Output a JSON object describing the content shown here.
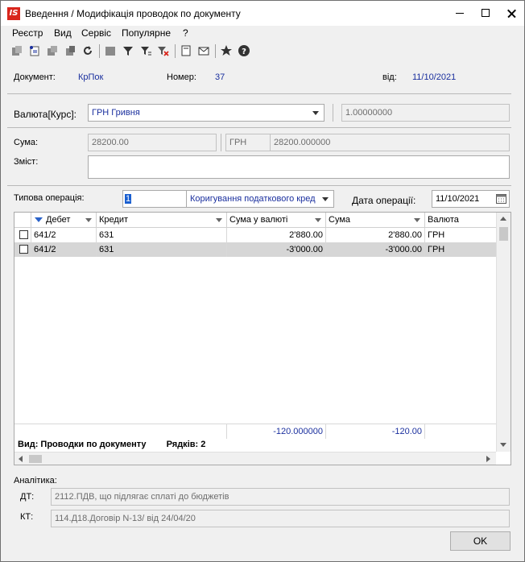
{
  "window": {
    "title": "Введення / Модифікація проводок по документу",
    "logo_text": "IS"
  },
  "menu": [
    "Реєстр",
    "Вид",
    "Сервіс",
    "Популярне",
    "?"
  ],
  "toolbar_icons": [
    "new-doc-icon",
    "open-doc-icon",
    "copy-doc-icon",
    "paste-doc-icon",
    "refresh-icon",
    "block-icon",
    "filter-icon",
    "filter-edit-icon",
    "clear-filter-icon",
    "page-icon",
    "mail-icon",
    "star-icon",
    "help-icon"
  ],
  "header": {
    "doc_label": "Документ:",
    "doc_value": "КрПок",
    "num_label": "Номер:",
    "num_value": "37",
    "date_label": "від:",
    "date_value": "11/10/2021"
  },
  "currency": {
    "label": "Валюта[Курс]:",
    "value": "ГРН Гривня",
    "rate": "1.00000000"
  },
  "amount": {
    "label": "Сума:",
    "value": "28200.00",
    "cur": "ГРН",
    "cur_value": "28200.000000"
  },
  "content": {
    "label": "Зміст:",
    "value": ""
  },
  "operation": {
    "label": "Типова операція:",
    "code": "1",
    "name": "Коригування податкового кред",
    "date_label": "Дата операції:",
    "date_value": "11/10/2021"
  },
  "grid": {
    "columns": [
      "Дебет",
      "Кредит",
      "Сума у валюті",
      "Сума",
      "Валюта"
    ],
    "rows": [
      {
        "debit": "641/2",
        "credit": "631",
        "sum_cur": "2'880.00",
        "sum": "2'880.00",
        "currency": "ГРН",
        "selected": false
      },
      {
        "debit": "641/2",
        "credit": "631",
        "sum_cur": "-3'000.00",
        "sum": "-3'000.00",
        "currency": "ГРН",
        "selected": true
      }
    ],
    "totals": {
      "sum_cur": "-120.000000",
      "sum": "-120.00"
    },
    "status_view": "Вид: Проводки по документу",
    "status_rows": "Рядків: 2"
  },
  "analytics": {
    "label": "Аналітика:",
    "dt_label": "ДТ:",
    "dt_value": "2112.ПДВ, що підлягає сплаті до бюджетів",
    "kt_label": "КТ:",
    "kt_value": "114.Д18.Договір N-13/ від 24/04/20"
  },
  "ok_label": "OK",
  "colors": {
    "blue_text": "#1a2f9e",
    "logo_red": "#d9261c",
    "selected_row": "#d6d6d6"
  }
}
